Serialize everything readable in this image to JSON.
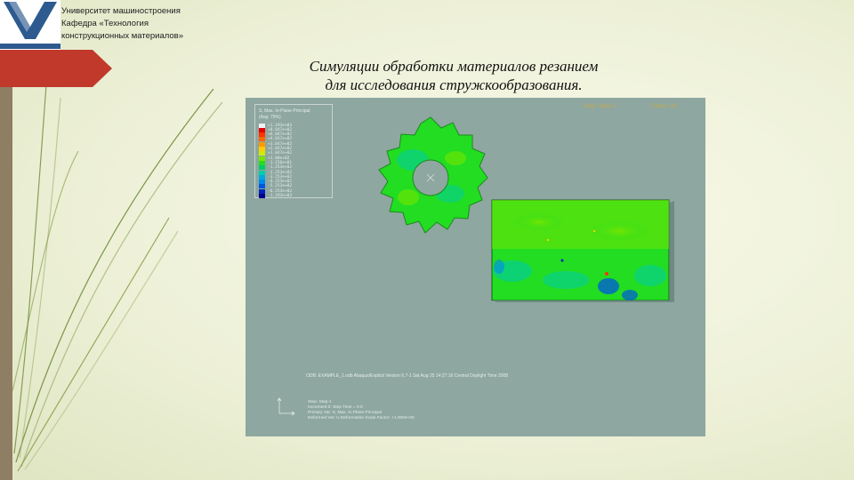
{
  "header": {
    "caption_lines": [
      "Университет машиностроения",
      "Кафедра «Технология",
      "конструкционных материалов»"
    ]
  },
  "title_lines": [
    "Симуляции обработки материалов резанием",
    "для исследования стружкообразования."
  ],
  "viewer": {
    "legend_header": [
      "S, Max. In-Plane Principal",
      "(Avg: 75%)"
    ],
    "legend_values": [
      "+1.193e+03",
      "+8.847e+02",
      "+6.847e+02",
      "+4.847e+02",
      "+3.847e+02",
      "+2.847e+02",
      "+1.847e+02",
      "+1.00e+02",
      "-1.156e+01",
      "-1.253e+02",
      "-2.253e+02",
      "-3.253e+02",
      "-4.253e+02",
      "-5.253e+02",
      "-6.253e+02",
      "-1.193e+03"
    ],
    "legend_colors": [
      "#f2f2f2",
      "#e60000",
      "#ff3300",
      "#ff6600",
      "#ff9900",
      "#ffcc00",
      "#ccee00",
      "#77e600",
      "#22dd22",
      "#00cc66",
      "#00ccaa",
      "#00aadd",
      "#0088ee",
      "#0055dd",
      "#0022bb",
      "#00008b"
    ],
    "top_right_left": "Step: Step-1",
    "top_right_right": "Frame: 40",
    "footer_line": "ODB: EXAMPLE_1.odb    Abaqus/Explicit Version 6.7-1    Sat Aug 25 14:27:16 Central Daylight Time 2008",
    "step_info": [
      "Step: Step-1",
      "Increment     0: Step Time = 0.0",
      "Primary Var: S, Max. In-Plane Principal",
      "Deformed Var: U   Deformation Scale Factor: +1.000e+00"
    ]
  },
  "colors": {
    "viewport_bg": "#8ea7a0",
    "accent_red": "#c0392b",
    "bar_brown": "#8e7e63",
    "stress_green": "#22dd22"
  }
}
